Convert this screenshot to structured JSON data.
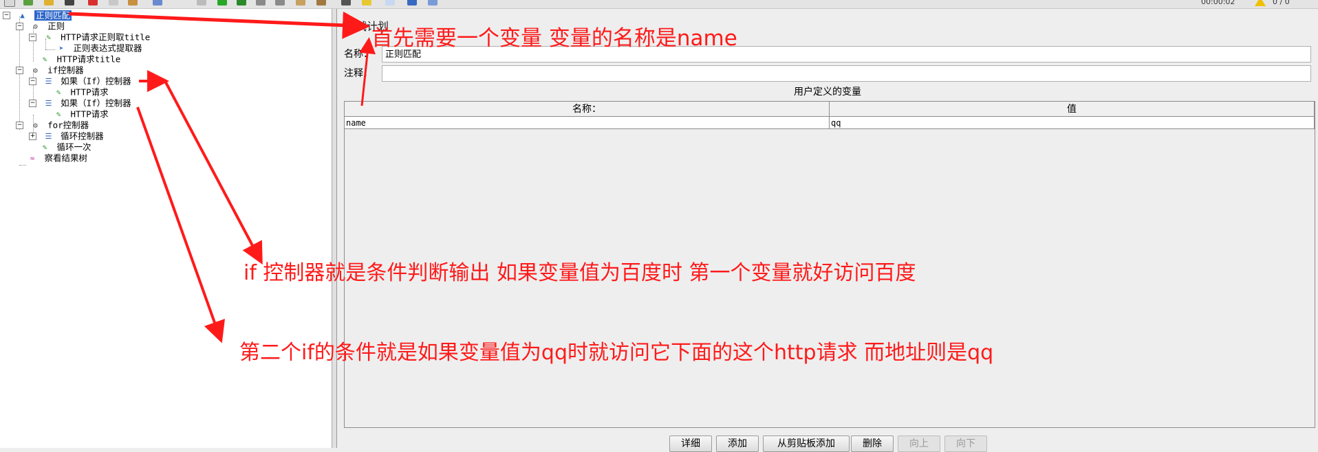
{
  "tree": {
    "items": [
      {
        "label": "正则匹配",
        "icon": "test-plan-icon",
        "selected": true
      },
      {
        "label": "正则",
        "icon": "thread-group-icon"
      },
      {
        "label": "HTTP请求正则取title",
        "icon": "http-sampler-icon"
      },
      {
        "label": "正则表达式提取器",
        "icon": "extractor-icon"
      },
      {
        "label": "HTTP请求title",
        "icon": "http-sampler-icon"
      },
      {
        "label": "if控制器",
        "icon": "thread-group-icon"
      },
      {
        "label": "如果（If）控制器",
        "icon": "if-controller-icon"
      },
      {
        "label": "HTTP请求",
        "icon": "http-sampler-icon"
      },
      {
        "label": "如果（If）控制器",
        "icon": "if-controller-icon"
      },
      {
        "label": "HTTP请求",
        "icon": "http-sampler-icon"
      },
      {
        "label": "for控制器",
        "icon": "thread-group-icon"
      },
      {
        "label": "循环控制器",
        "icon": "loop-controller-icon"
      },
      {
        "label": "循环一次",
        "icon": "http-sampler-icon"
      },
      {
        "label": "察看结果树",
        "icon": "results-tree-icon"
      }
    ]
  },
  "panel": {
    "section_title": "测试计划",
    "name_label": "名称：",
    "name_value": "正则匹配",
    "comment_label": "注释：",
    "comment_value": "",
    "udv_title": "用户定义的变量",
    "table": {
      "headers": [
        "名称：",
        "值"
      ],
      "rows": [
        [
          "name",
          "qq"
        ]
      ]
    },
    "buttons": {
      "detail": "详细",
      "add": "添加",
      "add_clipboard": "从剪贴板添加",
      "delete": "删除",
      "up": "向上",
      "down": "向下"
    }
  },
  "annotations": {
    "a1": "首先需要一个变量 变量的名称是name",
    "a2": "if 控制器就是条件判断输出 如果变量值为百度时 第一个变量就好访问百度",
    "a3": "第二个if的条件就是如果变量值为qq时就访问它下面的这个http请求 而地址则是qq"
  },
  "colors": {
    "annotation": "#ff1a1a",
    "selection": "#2a64c8"
  }
}
